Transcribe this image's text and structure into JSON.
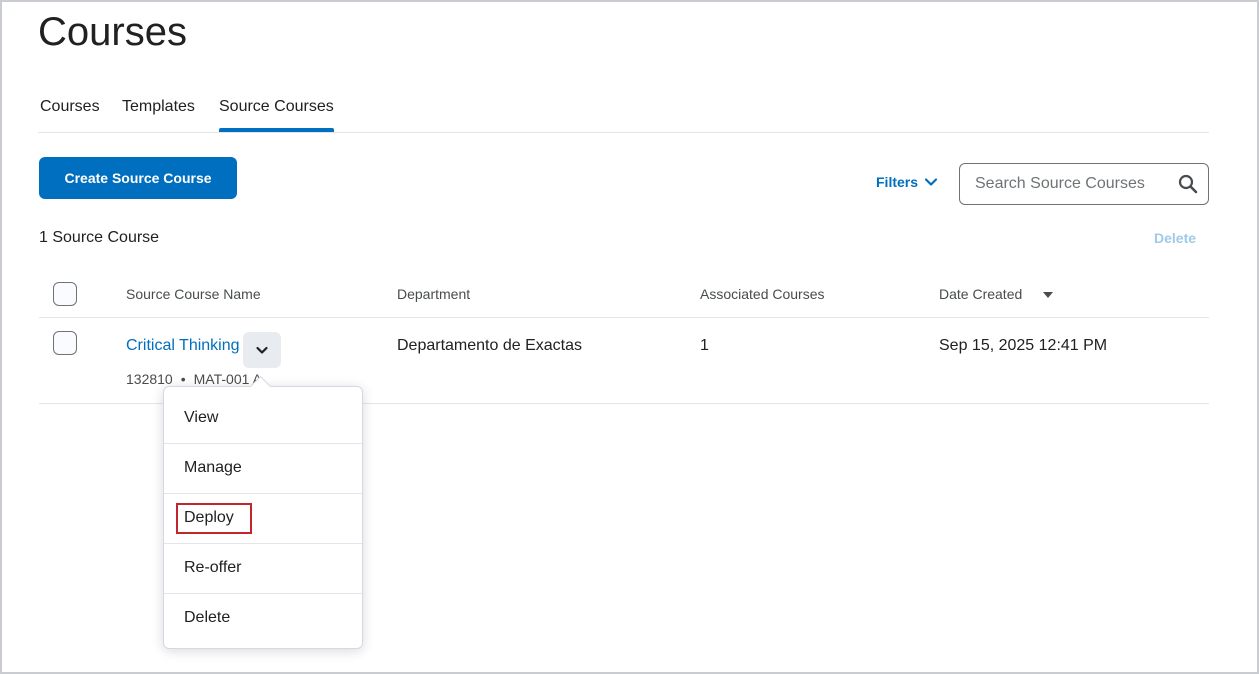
{
  "page": {
    "title": "Courses"
  },
  "tabs": [
    {
      "label": "Courses",
      "active": false
    },
    {
      "label": "Templates",
      "active": false
    },
    {
      "label": "Source Courses",
      "active": true
    }
  ],
  "toolbar": {
    "create_label": "Create Source Course",
    "filters_label": "Filters",
    "search_placeholder": "Search Source Courses"
  },
  "list": {
    "count_label": "1 Source Course",
    "delete_label": "Delete",
    "columns": [
      "Source Course Name",
      "Department",
      "Associated Courses",
      "Date Created"
    ],
    "sort_column": "Date Created",
    "rows": [
      {
        "name": "Critical Thinking",
        "id": "132810",
        "code": "MAT-001 A",
        "department": "Departamento de Exactas",
        "associated": "1",
        "date_created": "Sep 15, 2025 12:41 PM"
      }
    ]
  },
  "menu": {
    "items": [
      "View",
      "Manage",
      "Deploy",
      "Re-offer",
      "Delete"
    ],
    "highlighted": "Deploy"
  },
  "colors": {
    "accent": "#006fbf",
    "highlight": "#c0272d"
  }
}
